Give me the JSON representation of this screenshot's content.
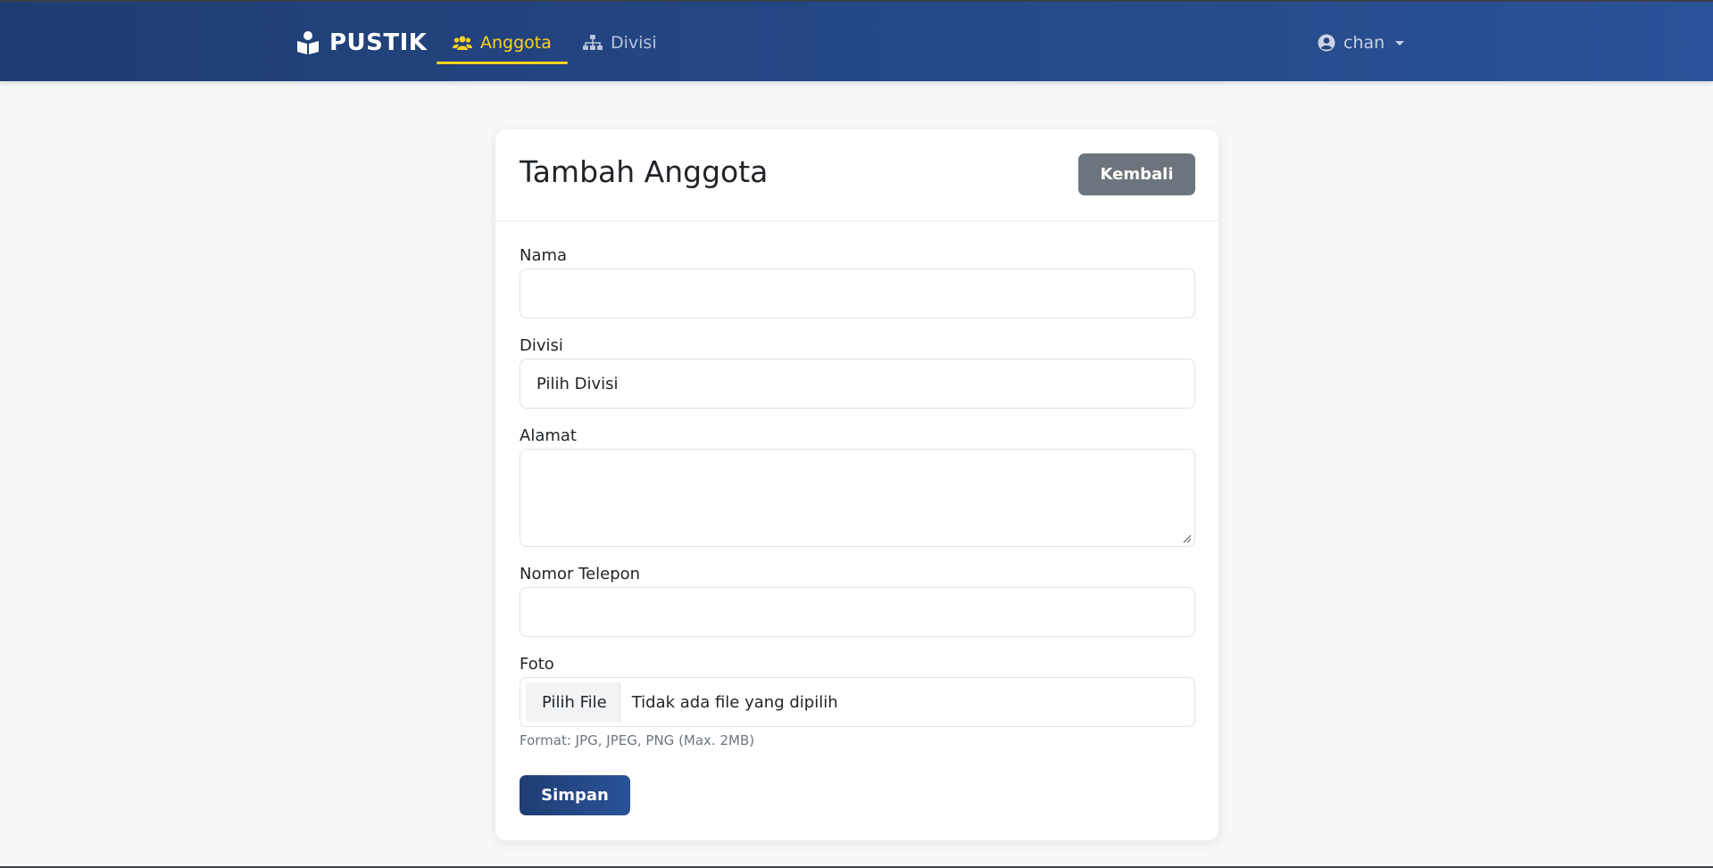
{
  "navbar": {
    "brand": "PUSTIK",
    "brand_icon": "book-reader-icon",
    "links": [
      {
        "label": "Anggota",
        "icon": "users-icon",
        "active": true
      },
      {
        "label": "Divisi",
        "icon": "sitemap-icon",
        "active": false
      }
    ],
    "user": {
      "name": "chan",
      "icon": "user-circle-icon"
    },
    "colors": {
      "bar_start": "#1f3d73",
      "bar_end": "#2a5298",
      "active": "#ffd21f"
    }
  },
  "card": {
    "title": "Tambah Anggota",
    "back_label": "Kembali"
  },
  "form": {
    "nama": {
      "label": "Nama",
      "value": ""
    },
    "divisi": {
      "label": "Divisi",
      "selected": "Pilih Divisi"
    },
    "alamat": {
      "label": "Alamat",
      "value": ""
    },
    "telepon": {
      "label": "Nomor Telepon",
      "value": ""
    },
    "foto": {
      "label": "Foto",
      "button": "Pilih File",
      "status": "Tidak ada file yang dipilih",
      "help": "Format: JPG, JPEG, PNG (Max. 2MB)"
    },
    "submit_label": "Simpan"
  }
}
